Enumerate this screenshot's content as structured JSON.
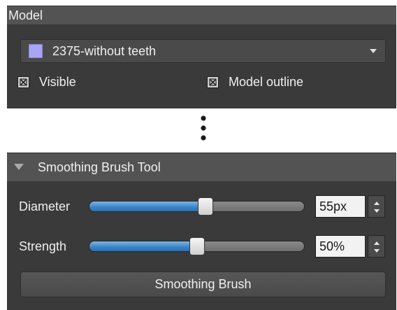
{
  "model_panel": {
    "title": "Model",
    "model_select": {
      "selected": "2375-without teeth",
      "swatch_color": "#aaa4f6"
    },
    "visible": {
      "label": "Visible",
      "checked": true
    },
    "model_outline": {
      "label": "Model outline",
      "checked": true
    }
  },
  "separator": {
    "icon": "vertical-ellipsis-icon"
  },
  "brush_panel": {
    "title": "Smoothing Brush Tool",
    "collapsed": false,
    "diameter": {
      "label": "Diameter",
      "value_text": "55px",
      "fraction": 0.54
    },
    "strength": {
      "label": "Strength",
      "value_text": "50%",
      "fraction": 0.5
    },
    "action_label": "Smoothing Brush"
  },
  "colors": {
    "panel_bg": "#3a3a3a",
    "header_bg": "#535353",
    "slider_fill": "#3a86c9"
  }
}
